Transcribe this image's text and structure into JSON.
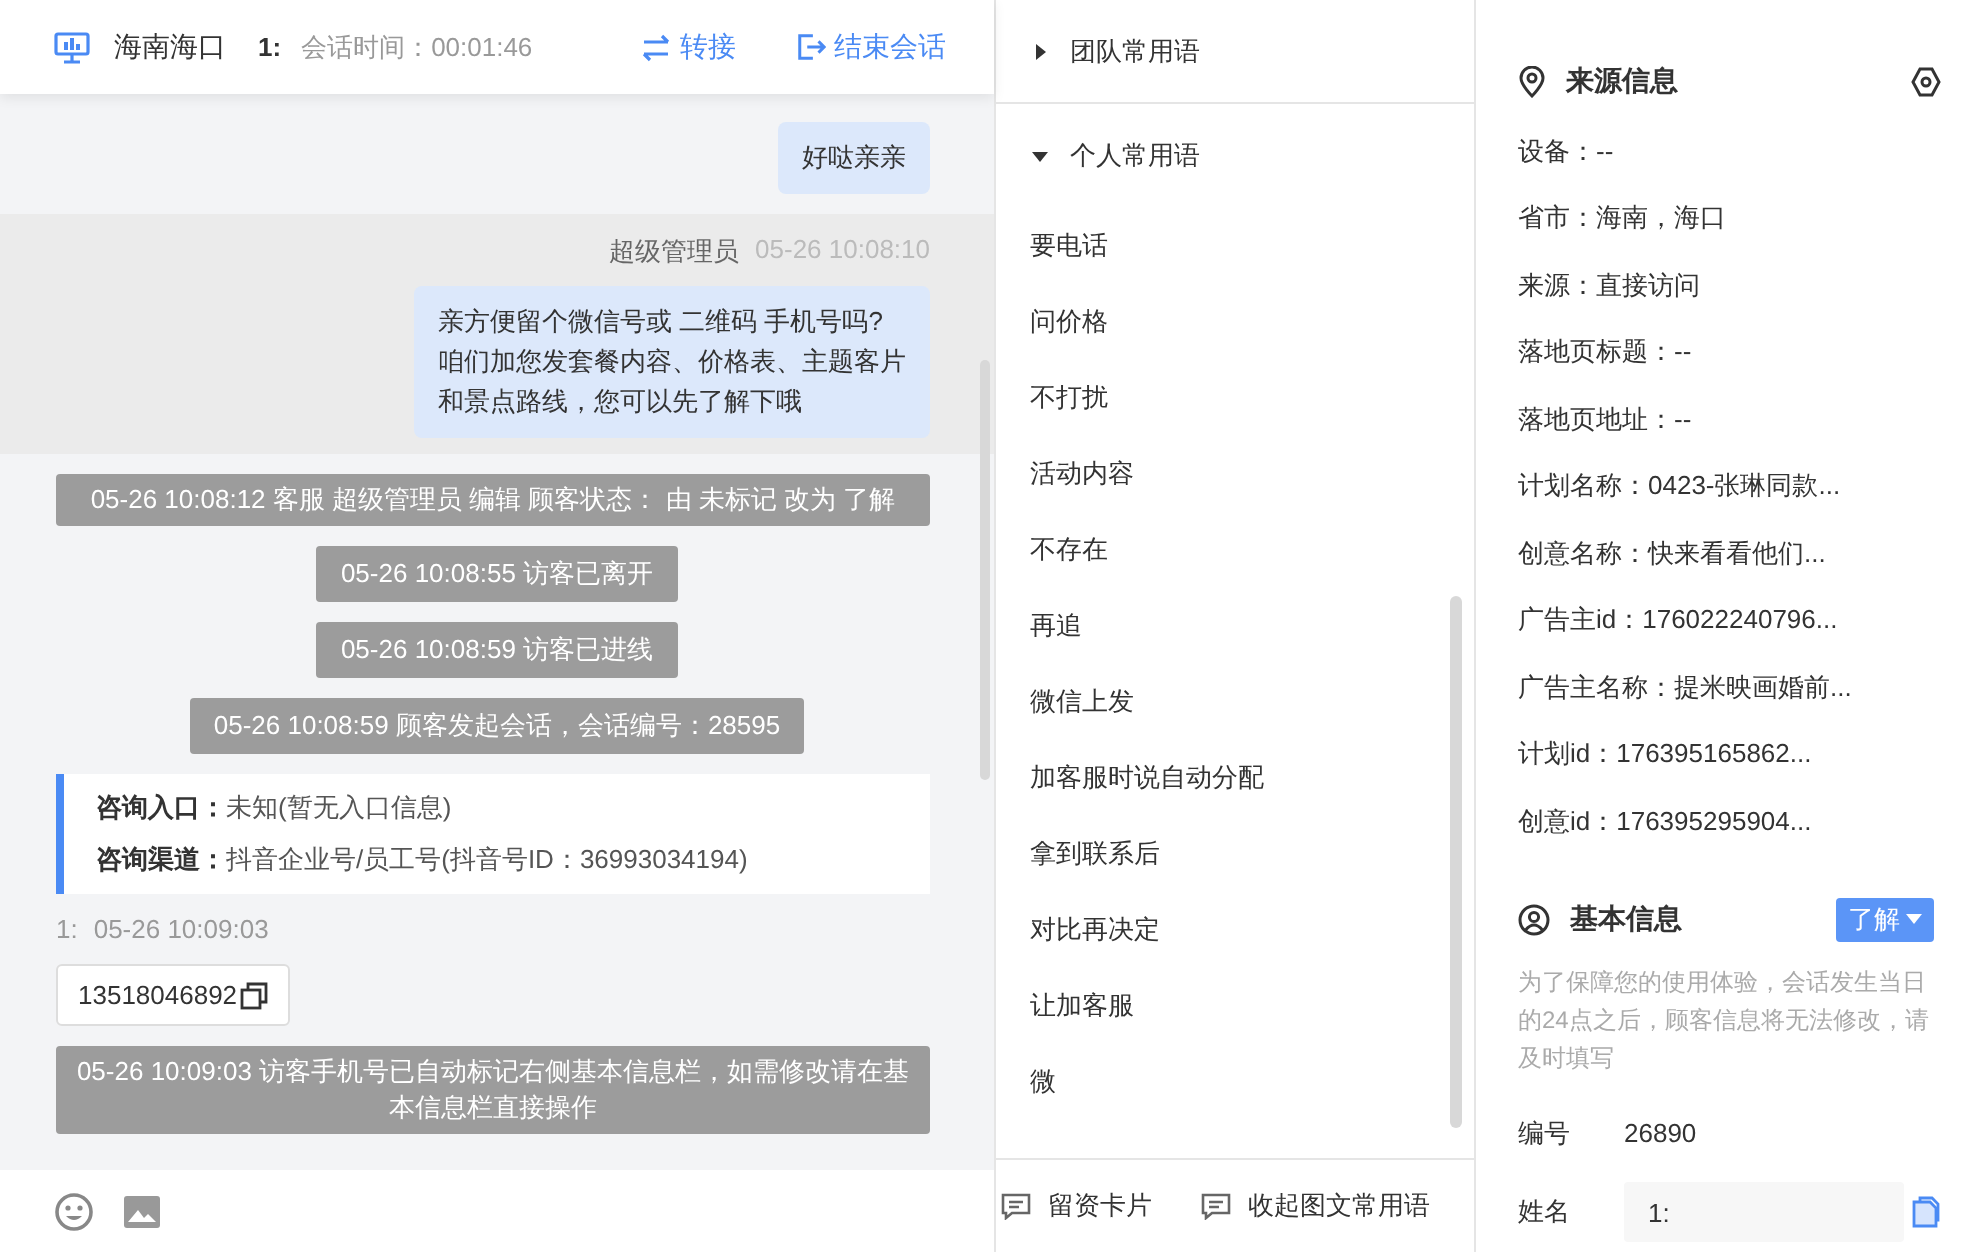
{
  "chat": {
    "header": {
      "location": "海南海口",
      "visitor": "1:",
      "session_time": "会话时间：00:01:46",
      "actions": [
        {
          "kind": "transfer",
          "label": "转接"
        },
        {
          "kind": "end",
          "label": "结束会话"
        }
      ]
    },
    "messages": [
      {
        "kind": "agent",
        "highlighted": false,
        "text": "好哒亲亲"
      },
      {
        "kind": "agent",
        "highlighted": true,
        "sender": "超级管理员",
        "time": "05-26 10:08:10",
        "lines": [
          "亲方便留个微信号或 二维码 手机号吗?",
          "咱们加您发套餐内容、价格表、主题客片",
          "和景点路线，您可以先了解下哦"
        ]
      },
      {
        "kind": "system",
        "text": "05-26 10:08:12 客服 超级管理员 编辑 顾客状态： 由 未标记 改为 了解"
      },
      {
        "kind": "system",
        "text": "05-26 10:08:55 访客已离开"
      },
      {
        "kind": "system",
        "text": "05-26 10:08:59 访客已进线"
      },
      {
        "kind": "system",
        "text": "05-26 10:08:59 顾客发起会话，会话编号：28595"
      },
      {
        "kind": "info_card",
        "rows": [
          {
            "label": "咨询入口：",
            "value": "未知(暂无入口信息)"
          },
          {
            "label": "咨询渠道：",
            "value": "抖音企业号/员工号(抖音号ID：36993034194)"
          }
        ]
      },
      {
        "kind": "visitor",
        "sender": "1:",
        "time": "05-26 10:09:03",
        "text": "13518046892"
      },
      {
        "kind": "system",
        "text": "05-26 10:09:03 访客手机号已自动标记右侧基本信息栏，如需修改请在基本信息栏直接操作"
      }
    ]
  },
  "phrases": {
    "groups": [
      {
        "title": "团队常用语",
        "expanded": false
      },
      {
        "title": "个人常用语",
        "expanded": true,
        "items": [
          "要电话",
          "问价格",
          "不打扰",
          "活动内容",
          "不存在",
          "再追",
          "微信上发",
          "加客服时说自动分配",
          "拿到联系后",
          "对比再决定",
          "让加客服",
          "微"
        ]
      }
    ],
    "footer": [
      "留资卡片",
      "收起图文常用语"
    ]
  },
  "info": {
    "source": {
      "title": "来源信息",
      "rows": [
        "设备：--",
        "省市：海南，海口",
        "来源：直接访问",
        "落地页标题：--",
        "落地页地址：--",
        "计划名称：0423-张琳同款...",
        "创意名称：快来看看他们...",
        "广告主id：176022240796...",
        "广告主名称：提米映画婚前...",
        "计划id：176395165862...",
        "创意id：176395295904..."
      ]
    },
    "basic": {
      "title": "基本信息",
      "status": "了解",
      "note": "为了保障您的使用体验，会话发生当日的24点之后，顾客信息将无法修改，请及时填写",
      "fields": [
        {
          "kind": "text",
          "label": "编号",
          "value": "26890"
        },
        {
          "kind": "input",
          "label": "姓名",
          "value": "1:"
        }
      ]
    }
  }
}
